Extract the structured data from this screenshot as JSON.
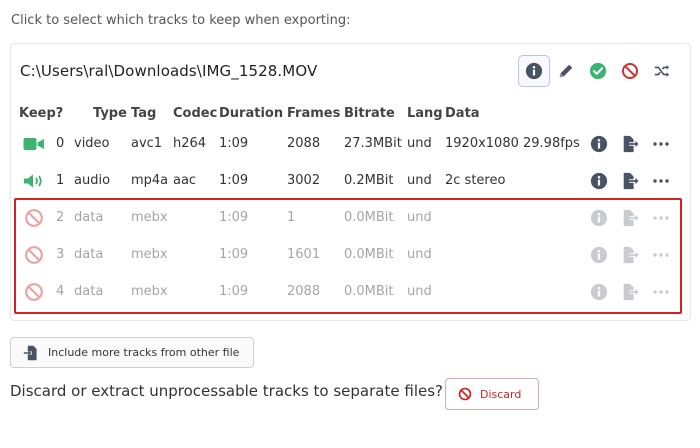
{
  "instructions": "Click to select which tracks to keep when exporting:",
  "file": {
    "path": "C:\\Users\\ral\\Downloads\\IMG_1528.MOV",
    "actions": [
      "info-icon",
      "pencil-icon",
      "check-circle-icon",
      "ban-icon",
      "shuffle-icon"
    ]
  },
  "headers": {
    "keep": "Keep?",
    "type": "Type",
    "tag": "Tag",
    "codec": "Codec",
    "duration": "Duration",
    "frames": "Frames",
    "bitrate": "Bitrate",
    "lang": "Lang",
    "data": "Data"
  },
  "tracks": [
    {
      "keep_icon": "video-camera-icon",
      "index": "0",
      "type": "video",
      "tag": "avc1",
      "codec": "h264",
      "duration": "1:09",
      "frames": "2088",
      "bitrate": "27.3MBit",
      "lang": "und",
      "data": "1920x1080 29.98fps",
      "enabled": true
    },
    {
      "keep_icon": "volume-icon",
      "index": "1",
      "type": "audio",
      "tag": "mp4a",
      "codec": "aac",
      "duration": "1:09",
      "frames": "3002",
      "bitrate": "0.2MBit",
      "lang": "und",
      "data": "2c stereo",
      "enabled": true
    },
    {
      "keep_icon": "ban-icon",
      "index": "2",
      "type": "data",
      "tag": "mebx",
      "codec": "",
      "duration": "1:09",
      "frames": "1",
      "bitrate": "0.0MBit",
      "lang": "und",
      "data": "",
      "enabled": false
    },
    {
      "keep_icon": "ban-icon",
      "index": "3",
      "type": "data",
      "tag": "mebx",
      "codec": "",
      "duration": "1:09",
      "frames": "1601",
      "bitrate": "0.0MBit",
      "lang": "und",
      "data": "",
      "enabled": false
    },
    {
      "keep_icon": "ban-icon",
      "index": "4",
      "type": "data",
      "tag": "mebx",
      "codec": "",
      "duration": "1:09",
      "frames": "2088",
      "bitrate": "0.0MBit",
      "lang": "und",
      "data": "",
      "enabled": false
    }
  ],
  "include_button": "Include more tracks from other file",
  "question": "Discard or extract unprocessable tracks to separate files?",
  "discard_button": "Discard",
  "colors": {
    "accent_green": "#3cb371",
    "danger_red": "#d32f2f",
    "highlight_red": "#d6221f",
    "icon_dark": "#4a5366"
  }
}
